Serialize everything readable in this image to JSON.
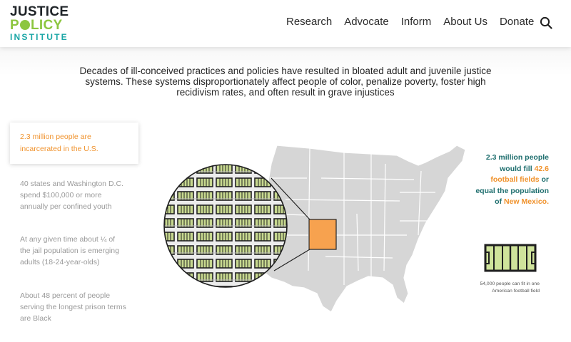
{
  "logo": {
    "line1": "JUSTICE",
    "line2_a": "P",
    "line2_b": "LICY",
    "line3": "INSTITUTE"
  },
  "nav": {
    "items": [
      {
        "label": "Research"
      },
      {
        "label": "Advocate"
      },
      {
        "label": "Inform"
      },
      {
        "label": "About Us"
      },
      {
        "label": "Donate"
      }
    ]
  },
  "intro": {
    "text": "Decades of ill-conceived practices and policies have resulted in bloated adult and juvenile justice systems. These systems disproportionately affect people of color, penalize poverty, foster high recidivism rates, and often result in grave injustices"
  },
  "facts": {
    "active": "2.3 million people are incarcerated in the U.S.",
    "items": [
      "40 states and Washington D.C. spend $100,000 or more annually per confined youth",
      "At any given time about ¼ of the jail population is emerging adults (18-24-year-olds)",
      "About 48 percent of people serving the longest prison terms are Black"
    ]
  },
  "stat": {
    "part1": "2.3 million people would fill ",
    "highlight1": "42.6 football fields",
    "part2": " or equal the population of ",
    "highlight2": "New Mexico."
  },
  "field_caption": "54,000 people can fit in one American football field",
  "colors": {
    "orange": "#f0922c",
    "teal": "#1e6e6e",
    "logo_green": "#8cc63f",
    "logo_teal": "#1aa6a6",
    "map_gray": "#d6d6d6"
  },
  "icons": {
    "search": "search-icon",
    "field": "football-field-icon"
  }
}
